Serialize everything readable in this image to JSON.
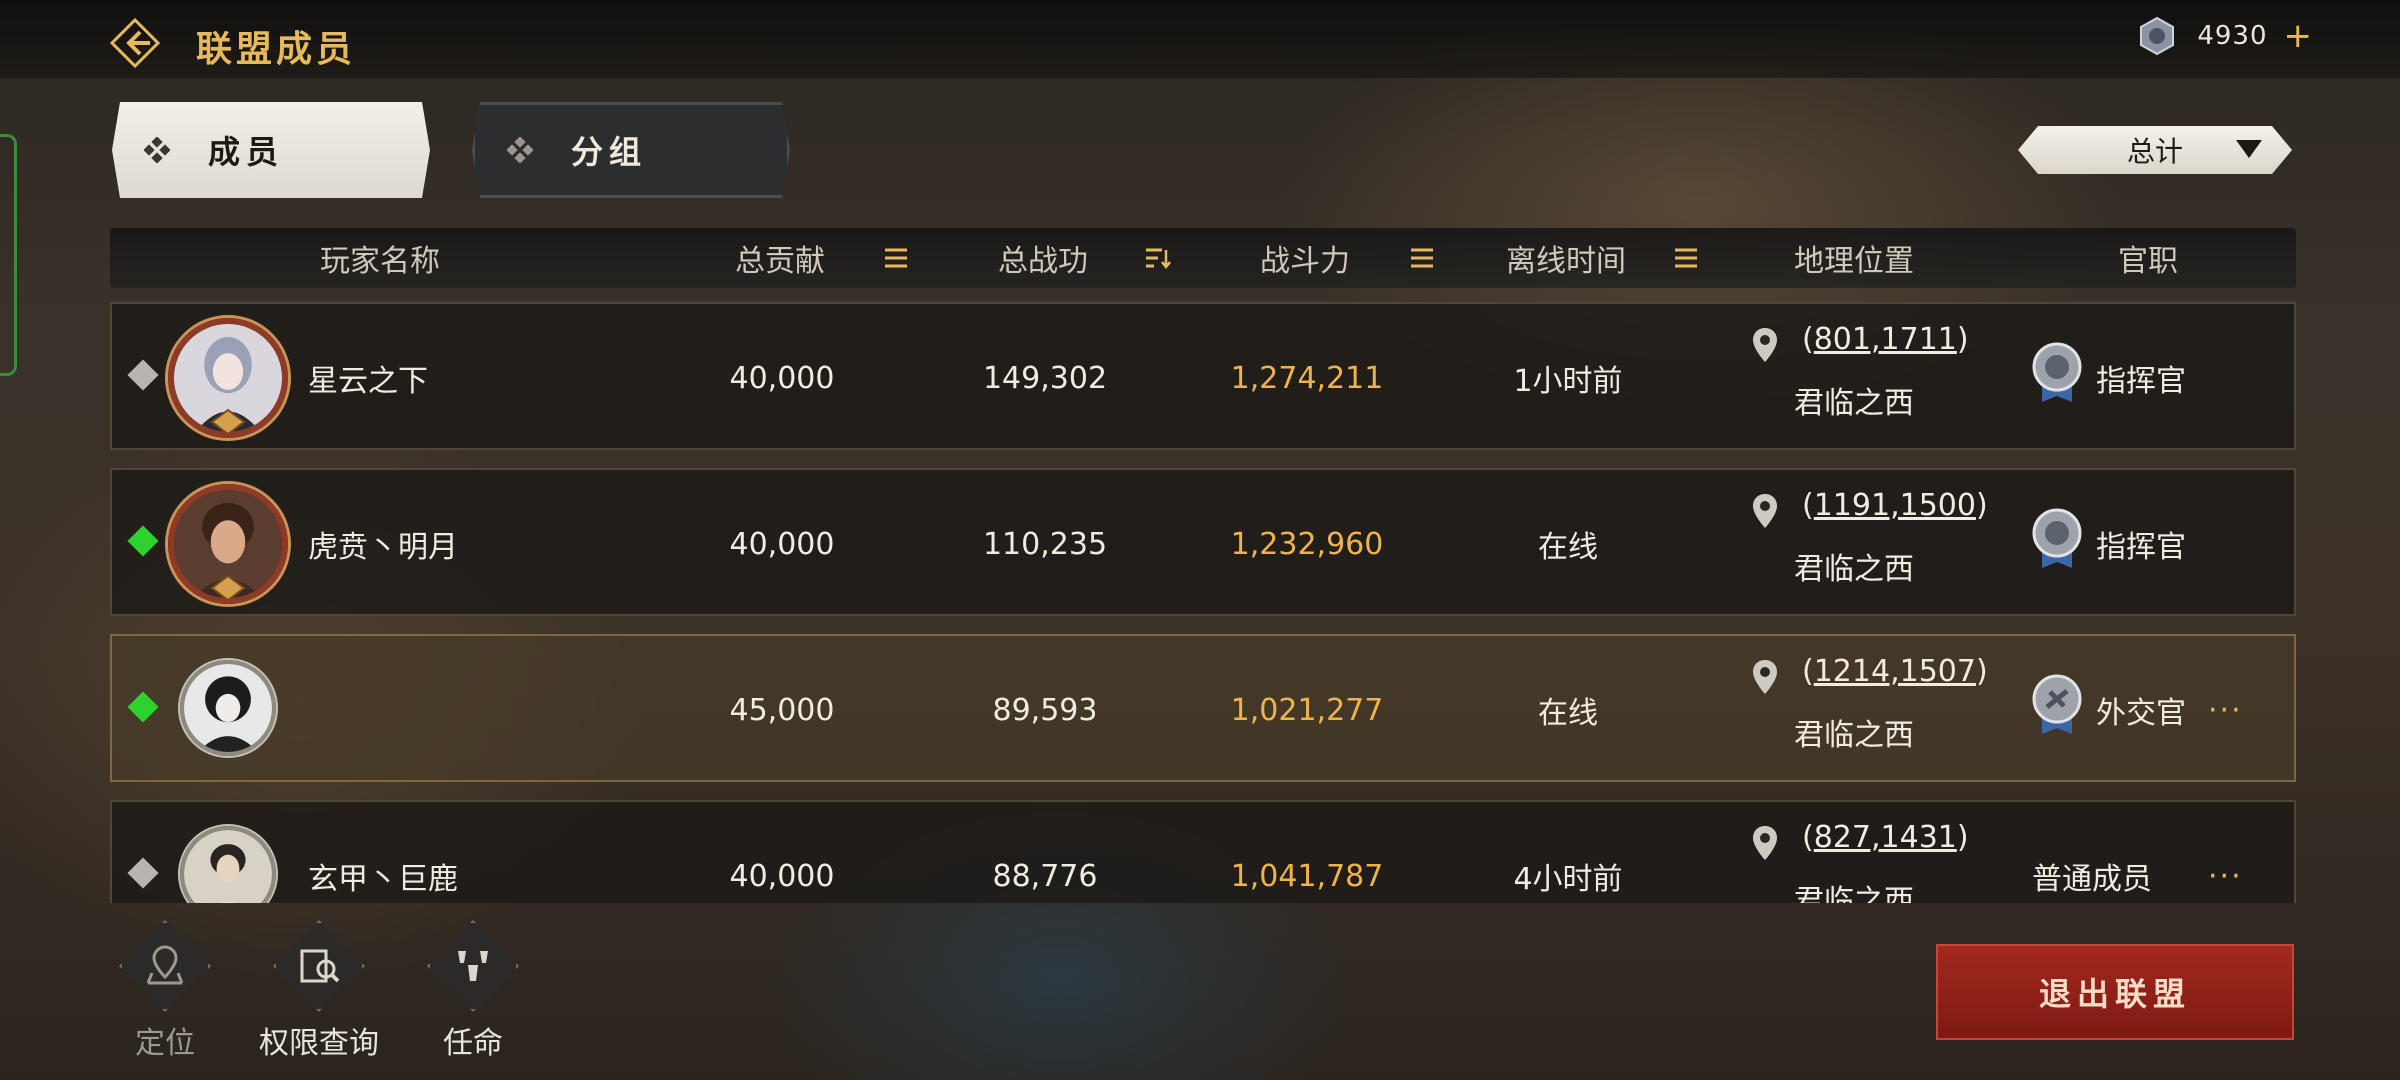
{
  "header": {
    "title": "联盟成员",
    "currency_value": "4930",
    "plus": "+"
  },
  "tabs": [
    {
      "label": "成员",
      "active": true
    },
    {
      "label": "分组",
      "active": false
    }
  ],
  "filter": {
    "selected": "总计"
  },
  "columns": [
    {
      "label": "玩家名称",
      "sortable": false
    },
    {
      "label": "总贡献",
      "sortable": true
    },
    {
      "label": "总战功",
      "sortable": true,
      "sorted": "desc"
    },
    {
      "label": "战斗力",
      "sortable": true
    },
    {
      "label": "离线时间",
      "sortable": true
    },
    {
      "label": "地理位置",
      "sortable": false
    },
    {
      "label": "官职",
      "sortable": false
    }
  ],
  "members": [
    {
      "name": "星云之下",
      "status": "offline",
      "contribution": "40,000",
      "merit": "149,302",
      "power": "1,274,211",
      "offline": "1小时前",
      "coords": "801,1711",
      "region": "君临之西",
      "rank": "指挥官",
      "rank_icon": true,
      "more": ""
    },
    {
      "name": "虎贲丶明月",
      "status": "online",
      "contribution": "40,000",
      "merit": "110,235",
      "power": "1,232,960",
      "offline": "在线",
      "coords": "1191,1500",
      "region": "君临之西",
      "rank": "指挥官",
      "rank_icon": true,
      "more": ""
    },
    {
      "name": "",
      "status": "online",
      "contribution": "45,000",
      "merit": "89,593",
      "power": "1,021,277",
      "offline": "在线",
      "coords": "1214,1507",
      "region": "君临之西",
      "rank": "外交官",
      "rank_icon": true,
      "more": "···"
    },
    {
      "name": "玄甲丶巨鹿",
      "status": "offline",
      "contribution": "40,000",
      "merit": "88,776",
      "power": "1,041,787",
      "offline": "4小时前",
      "coords": "827,1431",
      "region": "君临之西",
      "rank": "普通成员",
      "rank_icon": false,
      "more": "···"
    }
  ],
  "bottom_actions": [
    {
      "label": "定位",
      "icon": "map-pin-icon"
    },
    {
      "label": "权限查询",
      "icon": "permission-search-icon"
    },
    {
      "label": "任命",
      "icon": "appoint-icon"
    }
  ],
  "leave_button": "退出联盟",
  "colors": {
    "gold": "#e6b95a",
    "power": "#f0b34a",
    "online": "#2ed12e",
    "leave": "#9a241b"
  }
}
